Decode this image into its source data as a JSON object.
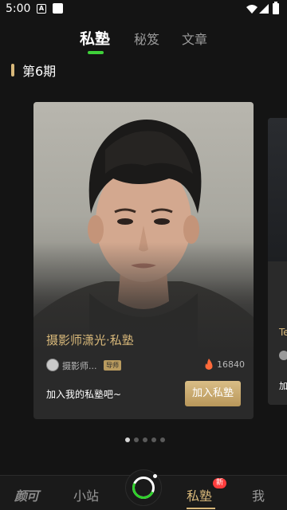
{
  "status_bar": {
    "time": "5:00",
    "a_label": "A"
  },
  "top_tabs": [
    {
      "label": "私塾",
      "active": true
    },
    {
      "label": "秘笈",
      "active": false
    },
    {
      "label": "文章",
      "active": false
    }
  ],
  "section": {
    "title": "第6期"
  },
  "card": {
    "title": "摄影师潇光·私塾",
    "author_name": "摄影师...",
    "author_badge": "导师",
    "hot_count": "16840",
    "slogan": "加入我的私塾吧~",
    "join_label": "加入私塾"
  },
  "next_card": {
    "title": "Te",
    "text": "加"
  },
  "pager": {
    "count": 5,
    "active_index": 0
  },
  "bottom_nav": {
    "logo": "颜可",
    "station": "小站",
    "private": "私塾",
    "private_badge": "新",
    "me": "我"
  },
  "colors": {
    "accent_gold": "#d8b87a",
    "accent_green": "#3fd13a",
    "badge_red": "#ff3d3d",
    "background": "#141414"
  }
}
